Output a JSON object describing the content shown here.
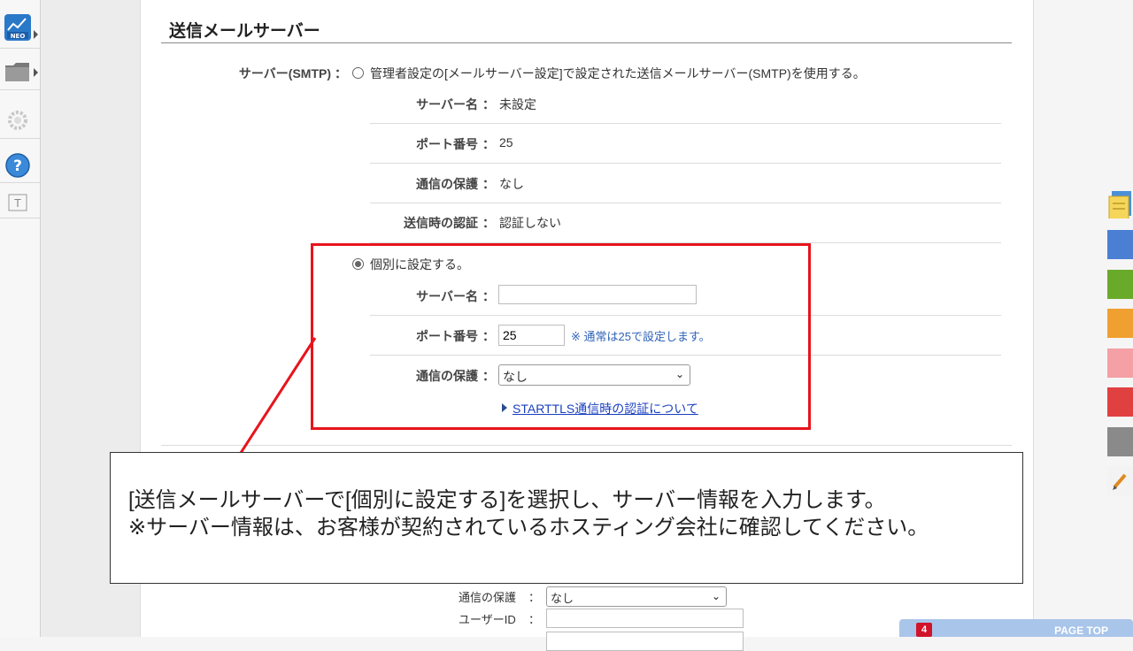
{
  "section_title": "送信メールサーバー",
  "smtp": {
    "label": "サーバー(SMTP)",
    "colon": "：",
    "option_admin": "管理者設定の[メールサーバー設定]で設定された送信メールサーバー(SMTP)を使用する。",
    "admin_rows": [
      {
        "label": "サーバー名",
        "value": "未設定"
      },
      {
        "label": "ポート番号",
        "value": "25"
      },
      {
        "label": "通信の保護",
        "value": "なし"
      },
      {
        "label": "送信時の認証",
        "value": "認証しない"
      }
    ],
    "option_custom": "個別に設定する。",
    "custom": {
      "server_label": "サーバー名",
      "server_value": "",
      "port_label": "ポート番号",
      "port_value": "25",
      "port_note": "※ 通常は25で設定します。",
      "protection_label": "通信の保護",
      "protection_value": "なし",
      "starttls_link": "STARTTLS通信時の認証について"
    }
  },
  "callout": {
    "line1": "[送信メールサーバーで[個別に設定する]を選択し、サーバー情報を入力します。",
    "line2": "※サーバー情報は、お客様が契約されているホスティング会社に確認してください。"
  },
  "below": {
    "protection_label": "通信の保護",
    "protection_value": "なし",
    "user_id_label": "ユーザーID",
    "colon": "："
  },
  "page_top": {
    "label": "PAGE TOP",
    "badge": "4"
  },
  "colors": {
    "accent_red": "#e8141c",
    "link": "#1a3fbf",
    "note": "#2f63b8"
  },
  "icons": [
    "neo-app-icon",
    "folder-icon",
    "gear-icon",
    "help-icon",
    "text-icon",
    "memo-icon",
    "pencil-icon"
  ]
}
